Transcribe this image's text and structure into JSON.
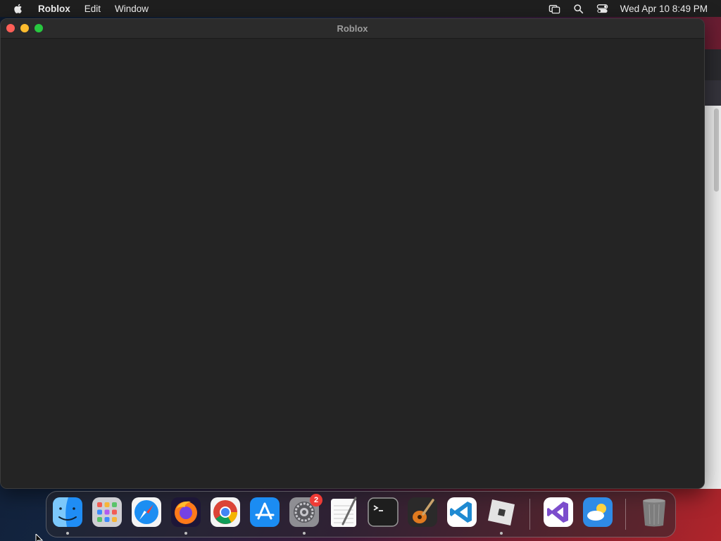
{
  "menubar": {
    "app_name": "Roblox",
    "menus": [
      "Edit",
      "Window"
    ],
    "clock": "Wed Apr 10  8:49 PM",
    "status_icons": [
      "screen-mirroring-icon",
      "search-icon",
      "control-center-icon"
    ]
  },
  "window": {
    "title": "Roblox"
  },
  "dock": {
    "items": [
      {
        "name": "Finder",
        "icon": "finder-icon",
        "running": true
      },
      {
        "name": "Launchpad",
        "icon": "launchpad-icon",
        "running": false
      },
      {
        "name": "Safari",
        "icon": "safari-icon",
        "running": false
      },
      {
        "name": "Firefox",
        "icon": "firefox-icon",
        "running": true
      },
      {
        "name": "Google Chrome",
        "icon": "chrome-icon",
        "running": false
      },
      {
        "name": "App Store",
        "icon": "app-store-icon",
        "running": false
      },
      {
        "name": "System Settings",
        "icon": "system-settings-icon",
        "running": true,
        "badge": "2"
      },
      {
        "name": "TextEdit",
        "icon": "textedit-icon",
        "running": false
      },
      {
        "name": "Terminal",
        "icon": "terminal-icon",
        "running": false
      },
      {
        "name": "GarageBand",
        "icon": "garageband-icon",
        "running": false
      },
      {
        "name": "Visual Studio Code",
        "icon": "vscode-icon",
        "running": false
      },
      {
        "name": "Roblox",
        "icon": "roblox-icon",
        "running": true
      },
      {
        "name": "Visual Studio",
        "icon": "visual-studio-icon",
        "running": false
      },
      {
        "name": "Weather",
        "icon": "weather-icon",
        "running": false
      },
      {
        "name": "Trash",
        "icon": "trash-icon",
        "running": false
      }
    ]
  },
  "colors": {
    "window_bg": "#242424",
    "menubar_bg": "#1f1f1f",
    "badge": "#ef3b36"
  }
}
